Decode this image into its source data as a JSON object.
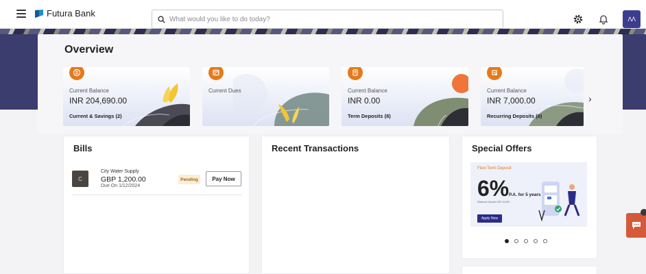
{
  "header": {
    "brand": "Futura Bank",
    "search_placeholder": "What would you like to do today?",
    "avatar_initials": "ΛΛ"
  },
  "overview": {
    "title": "Overview",
    "cards": [
      {
        "icon": "dollar-coin-icon",
        "label": "Current Balance",
        "amount": "INR 204,690.00",
        "sub": "Current & Savings (2)"
      },
      {
        "icon": "credit-card-icon",
        "label": "Current Dues",
        "amount": "",
        "sub": ""
      },
      {
        "icon": "deposit-icon",
        "label": "Current Balance",
        "amount": "INR 0.00",
        "sub": "Term Deposits (8)"
      },
      {
        "icon": "recurring-deposit-icon",
        "label": "Current Balance",
        "amount": "INR 7,000.00",
        "sub": "Recurring Deposits (8)"
      }
    ]
  },
  "bills": {
    "title": "Bills",
    "items": [
      {
        "logo": "C",
        "name": "City Water Supply",
        "amount": "GBP 1,200.00",
        "due": "Due On 1/12/2024",
        "status": "Pending",
        "action": "Pay Now"
      }
    ]
  },
  "recent_transactions": {
    "title": "Recent Transactions"
  },
  "special_offers": {
    "title": "Special Offers",
    "offer": {
      "tag": "Flexi Term Deposit",
      "rate": "6%",
      "pa": "P.A. for 5 years",
      "min": "Minimum Deposit USD 10,000",
      "apply": "Apply Now"
    },
    "dots_count": 5,
    "active_dot": 0
  },
  "colors": {
    "accent": "#e57a1a",
    "primary": "#2b2b8a",
    "banner": "#3a3d6e",
    "chat": "#d55a3a"
  }
}
